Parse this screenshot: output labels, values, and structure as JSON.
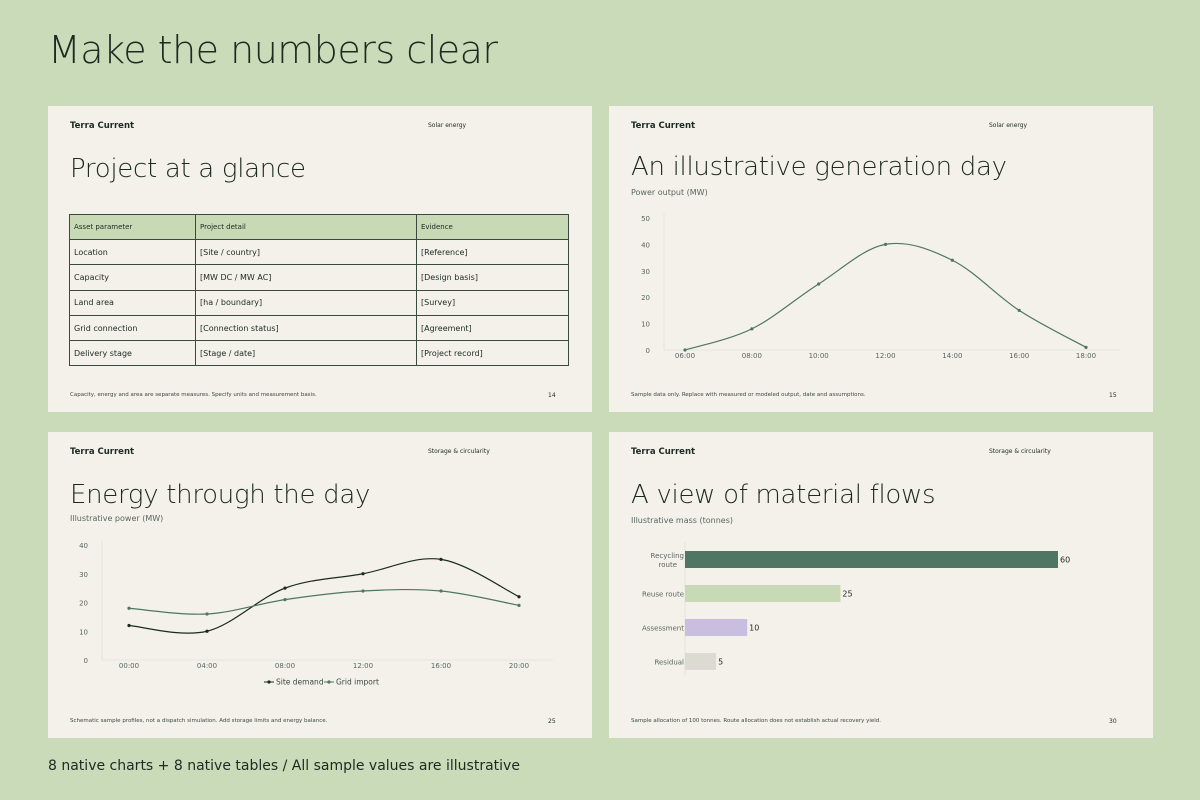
{
  "page": {
    "title": "Make the numbers clear",
    "caption": "8 native charts + 8 native tables  /  All sample values are illustrative"
  },
  "colors": {
    "background": "#c9dbb8",
    "slide": "#f3f1ea",
    "dark_green": "#4e7662",
    "line_dark": "#1a2a20",
    "light_green": "#c7dab5",
    "lavender": "#c9bedf",
    "grey": "#dcdbd2"
  },
  "slides": [
    {
      "brand": "Terra Current",
      "section": "Solar energy",
      "title": "Project at a glance",
      "note": "Capacity, energy and area are separate measures. Specify units and measurement basis.",
      "page_number": "14",
      "table": {
        "headers": [
          "Asset parameter",
          "Project detail",
          "Evidence"
        ],
        "rows": [
          [
            "Location",
            "[Site / country]",
            "[Reference]"
          ],
          [
            "Capacity",
            "[MW DC / MW AC]",
            "[Design basis]"
          ],
          [
            "Land area",
            "[ha / boundary]",
            "[Survey]"
          ],
          [
            "Grid connection",
            "[Connection status]",
            "[Agreement]"
          ],
          [
            "Delivery stage",
            "[Stage / date]",
            "[Project record]"
          ]
        ]
      }
    },
    {
      "brand": "Terra Current",
      "section": "Solar energy",
      "title": "An illustrative generation day",
      "subtitle": "Power output (MW)",
      "note": "Sample data only. Replace with measured or modeled output, date and assumptions.",
      "page_number": "15"
    },
    {
      "brand": "Terra Current",
      "section": "Storage & circularity",
      "title": "Energy through the day",
      "subtitle": "Illustrative power (MW)",
      "note": "Schematic sample profiles, not a dispatch simulation. Add storage limits and energy balance.",
      "page_number": "25"
    },
    {
      "brand": "Terra Current",
      "section": "Storage & circularity",
      "title": "A view of material flows",
      "subtitle": "Illustrative mass (tonnes)",
      "note": "Sample allocation of 100 tonnes. Route allocation does not establish actual recovery yield.",
      "page_number": "30"
    }
  ],
  "chart_data": [
    {
      "type": "line",
      "x": [
        "06:00",
        "08:00",
        "10:00",
        "12:00",
        "14:00",
        "16:00",
        "18:00"
      ],
      "series": [
        {
          "values": [
            0,
            8,
            25,
            40,
            34,
            15,
            1
          ]
        }
      ],
      "ylim": [
        0,
        50
      ],
      "yticks": [
        0,
        10,
        20,
        30,
        40,
        50
      ],
      "grid": false
    },
    {
      "type": "line",
      "x": [
        "00:00",
        "04:00",
        "08:00",
        "12:00",
        "16:00",
        "20:00"
      ],
      "series": [
        {
          "name": "Site demand",
          "values": [
            12,
            10,
            25,
            30,
            35,
            22
          ]
        },
        {
          "name": "Grid import",
          "values": [
            18,
            16,
            21,
            24,
            24,
            19
          ]
        }
      ],
      "ylim": [
        0,
        40
      ],
      "yticks": [
        0,
        10,
        20,
        30,
        40
      ],
      "legend": "bottom-center",
      "grid": false
    },
    {
      "type": "bar",
      "orientation": "horizontal",
      "categories": [
        "Recycling route",
        "Reuse route",
        "Assessment",
        "Residual"
      ],
      "values": [
        60,
        25,
        10,
        5
      ],
      "colors": [
        "#4e7662",
        "#c7dab5",
        "#c9bedf",
        "#dcdbd2"
      ],
      "xlim": [
        0,
        60
      ]
    }
  ]
}
